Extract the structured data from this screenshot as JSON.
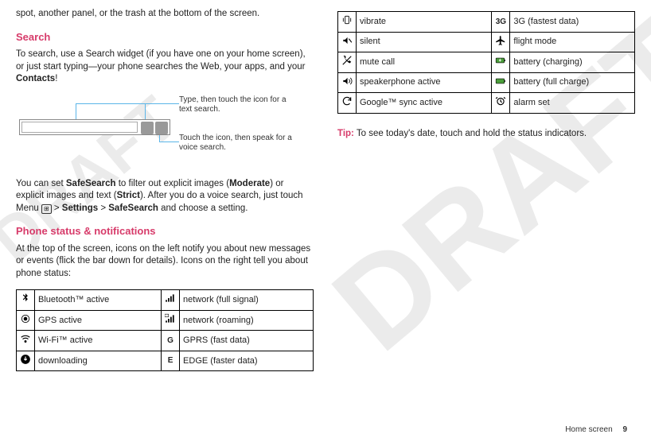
{
  "watermark1": "DRAFT",
  "watermark2": "DRAFT",
  "left": {
    "intro_fragment": "spot, another panel, or the trash at the bottom of the screen.",
    "search_heading": "Search",
    "search_p1_a": "To search, use a Search widget (if you have one on your home screen), or just start typing—your phone searches the Web, your apps, and your ",
    "search_p1_b": "Contacts",
    "search_p1_c": "!",
    "callout1": "Type, then touch the icon for a text search.",
    "callout2": "Touch the icon, then speak for a voice search.",
    "safesearch_a": "You can set ",
    "safesearch_b": "SafeSearch",
    "safesearch_c": " to filter out explicit images (",
    "safesearch_d": "Moderate",
    "safesearch_e": ") or explicit images and text (",
    "safesearch_f": "Strict",
    "safesearch_g": "). After you do a voice search, just touch Menu ",
    "safesearch_h": " > ",
    "safesearch_i": "Settings",
    "safesearch_j": " > ",
    "safesearch_k": "SafeSearch",
    "safesearch_l": " and choose a setting.",
    "status_heading": "Phone status & notifications",
    "status_intro": "At the top of the screen, icons on the left notify you about new messages or events (flick the bar down for details). Icons on the right tell you about phone status:",
    "table1": {
      "r1c1": "Bluetooth™ active",
      "r1c2": "network (full signal)",
      "r2c1": "GPS active",
      "r2c2": "network (roaming)",
      "r3c1": "Wi-Fi™ active",
      "r3c2": "GPRS (fast data)",
      "r4c1": "downloading",
      "r4c2": "EDGE (faster data)"
    }
  },
  "right": {
    "table2": {
      "r1c1": "vibrate",
      "r1i2": "3G",
      "r1c2": "3G (fastest data)",
      "r2c1": "silent",
      "r2c2": "flight mode",
      "r3c1": "mute call",
      "r3c2": "battery (charging)",
      "r4c1": "speakerphone active",
      "r4c2": "battery (full charge)",
      "r5c1": "Google™ sync active",
      "r5c2": "alarm set"
    },
    "tip_label": "Tip:",
    "tip_text": " To see today's date, touch and hold the status indicators."
  },
  "footer": {
    "section": "Home screen",
    "page": "9"
  },
  "icons": {
    "menu": "⊞"
  }
}
